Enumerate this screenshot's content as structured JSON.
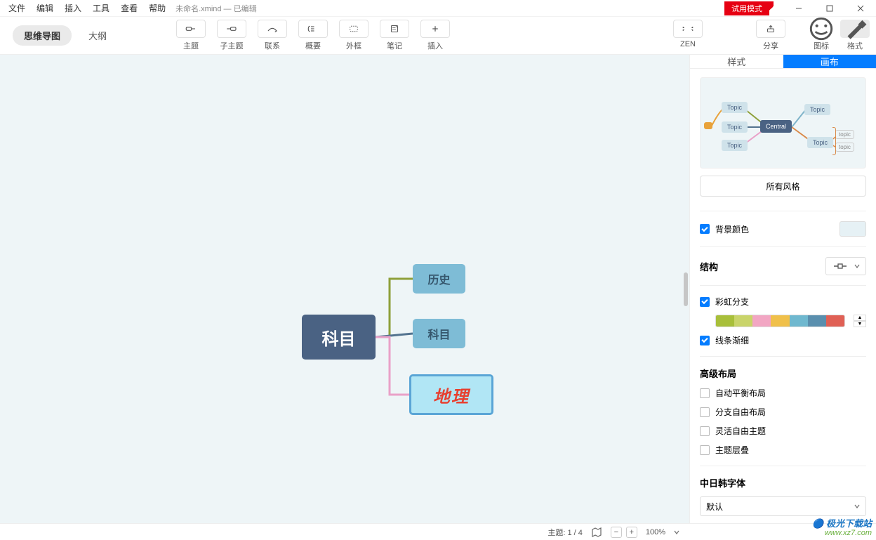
{
  "menu": {
    "file": "文件",
    "edit": "编辑",
    "insert": "插入",
    "tool": "工具",
    "view": "查看",
    "help": "帮助"
  },
  "doc": {
    "title": "未命名.xmind  — 已编辑"
  },
  "trial_mode": "试用模式",
  "view_tabs": {
    "mindmap": "思维导图",
    "outline": "大纲"
  },
  "tools": {
    "topic": "主题",
    "subtopic": "子主题",
    "relation": "联系",
    "summary": "概要",
    "boundary": "外框",
    "note": "笔记",
    "insert": "插入",
    "zen": "ZEN",
    "share": "分享",
    "icons": "图标",
    "format": "格式"
  },
  "mindmap": {
    "central": "科目",
    "sub1": "历史",
    "sub2": "科目",
    "sub3": "地理"
  },
  "panel": {
    "tab_style": "样式",
    "tab_canvas": "画布",
    "preview": {
      "topic": "Topic",
      "central": "Central"
    },
    "all_styles": "所有风格",
    "bg_color": "背景颜色",
    "structure": "结构",
    "rainbow": "彩虹分支",
    "taper": "线条渐细",
    "advanced": "高级布局",
    "auto_balance": "自动平衡布局",
    "free_branch": "分支自由布局",
    "free_topic": "灵活自由主题",
    "overlap": "主题层叠",
    "cjk_font": "中日韩字体",
    "cjk_default": "默认"
  },
  "status": {
    "topic_count": "主题: 1 / 4",
    "zoom": "100%"
  },
  "watermark": {
    "top": "极光下载站",
    "bottom": "www.xz7.com"
  }
}
